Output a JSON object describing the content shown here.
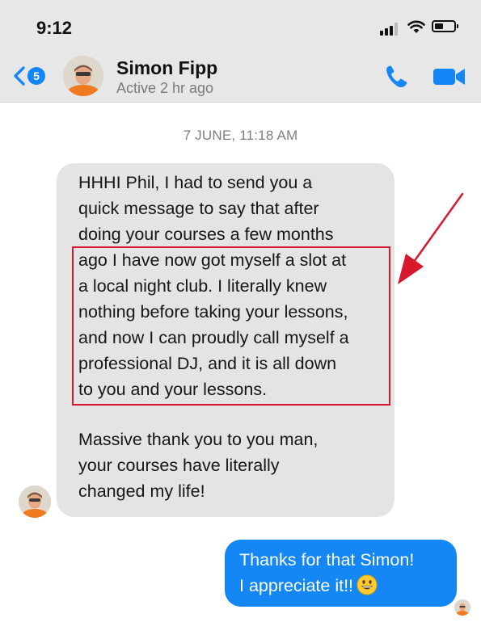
{
  "status_bar": {
    "time": "9:12"
  },
  "header": {
    "back_count": "5",
    "contact_name": "Simon Fipp",
    "contact_status": "Active 2 hr ago",
    "icons": [
      "back-chevron-icon",
      "phone-icon",
      "video-camera-icon"
    ],
    "accent_color": "#1486f5"
  },
  "conversation": {
    "date_stamp": "7 JUNE, 11:18 AM",
    "incoming_message": {
      "lines": [
        "HHHI Phil, I had to send you a",
        "quick message to say that after",
        "doing your courses a few months",
        "ago I have now got myself a slot at",
        "a local night club. I literally knew",
        "nothing before taking your lessons,",
        "and now I can proudly call myself a",
        "professional DJ, and it is all down",
        "to you and your lessons."
      ],
      "lines_2": [
        "Massive thank you to you man,",
        "your courses have literally",
        "changed my life!"
      ]
    },
    "outgoing_message": {
      "lines": [
        "Thanks for that Simon!",
        "I appreciate it!!"
      ],
      "emoji": "grinning-face-emoji"
    },
    "annotation": {
      "color": "#d8182b"
    }
  }
}
